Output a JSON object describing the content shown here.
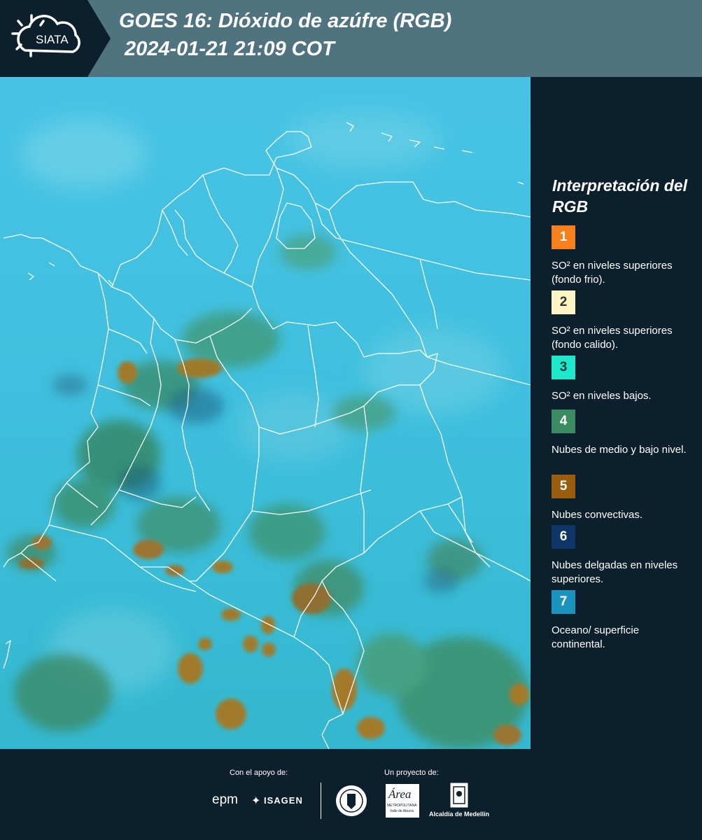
{
  "header": {
    "logo_text": "SIATA",
    "title_line1": "GOES 16: Dióxido de azúfre (RGB)",
    "title_line2": "2024-01-21 21:09 COT"
  },
  "legend": {
    "title": "Interpretación del RGB",
    "items": [
      {
        "number": "1",
        "color": "#f7801e",
        "text_color": "#ffffff",
        "description": "SO² en niveles superiores (fondo frio)."
      },
      {
        "number": "2",
        "color": "#fdf6c3",
        "text_color": "#333333",
        "description": "SO² en niveles superiores (fondo calido)."
      },
      {
        "number": "3",
        "color": "#1de8c9",
        "text_color": "#0b3b3b",
        "description": "SO² en niveles bajos."
      },
      {
        "number": "4",
        "color": "#3a8b62",
        "text_color": "#ffffff",
        "description": "Nubes de medio y bajo nivel."
      },
      {
        "number": "5",
        "color": "#9a5d0c",
        "text_color": "#ffffff",
        "description": "Nubes convectivas."
      },
      {
        "number": "6",
        "color": "#0d3565",
        "text_color": "#ffffff",
        "description": "Nubes delgadas en niveles superiores."
      },
      {
        "number": "7",
        "color": "#1a93be",
        "text_color": "#ffffff",
        "description": "Oceano/ superficie continental."
      }
    ]
  },
  "footer": {
    "support_label": "Con el apoyo de:",
    "project_label": "Un proyecto de:",
    "epm": "epm",
    "isagen": "ISAGEN",
    "area_name": "Área",
    "area_sub1": "METROPOLITANA",
    "area_sub2": "Valle de Aburrá",
    "alcaldia": "Alcaldía de Medellín"
  },
  "colors": {
    "header_bg": "#4f7480",
    "panel_bg": "#0c1f2c",
    "map_base": "#3fc1de"
  }
}
